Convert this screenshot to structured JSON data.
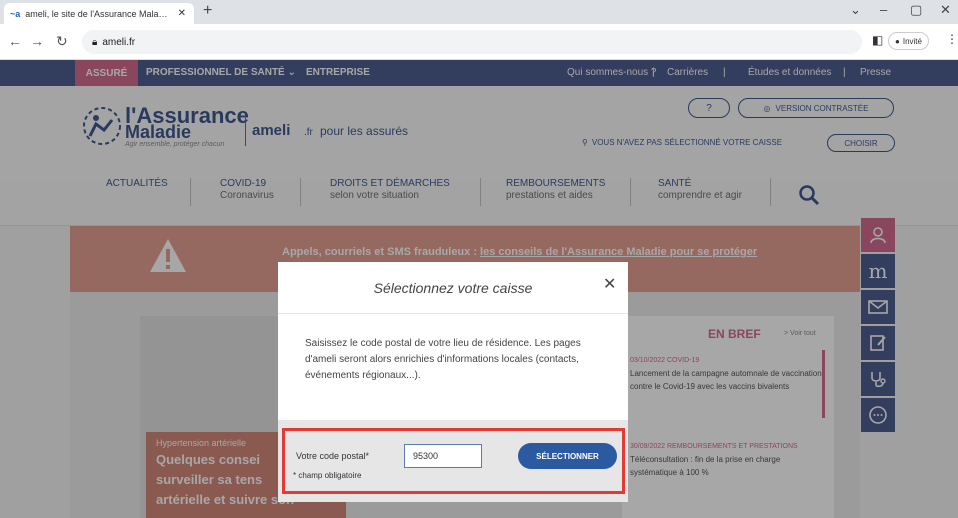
{
  "browser": {
    "tab_title": "ameli, le site de l'Assurance Mala…",
    "tab_favicon": "ameli",
    "url": "ameli.fr",
    "profile_label": "Invité"
  },
  "topnav": {
    "active": "ASSURÉ",
    "links": [
      "PROFESSIONNEL DE SANTÉ",
      "ENTREPRISE"
    ],
    "utility": [
      "Qui sommes-nous ?",
      "|",
      "Carrières",
      "|",
      "Études et données",
      "|",
      "Presse"
    ]
  },
  "header": {
    "logo_line1": "l'Assurance",
    "logo_line2": "Maladie",
    "logo_tagline": "Agir ensemble, protéger chacun",
    "site_name": "ameli",
    "site_tld": ".fr",
    "audience": "pour les assurés",
    "help_label": "?",
    "contrast_label": "VERSION CONTRASTÉE",
    "caisse_message": "VOUS N'AVEZ PAS SÉLECTIONNÉ VOTRE CAISSE",
    "choose_label": "CHOISIR"
  },
  "mainnav": [
    {
      "title": "ACTUALITÉS",
      "sub": ""
    },
    {
      "title": "COVID-19",
      "sub": "Coronavirus"
    },
    {
      "title": "DROITS ET DÉMARCHES",
      "sub": "selon votre situation"
    },
    {
      "title": "REMBOURSEMENTS",
      "sub": "prestations et aides"
    },
    {
      "title": "SANTÉ",
      "sub": "comprendre et agir"
    }
  ],
  "alert": {
    "text_plain": "Appels, courriels et SMS frauduleux : ",
    "text_link": "les conseils de l'Assurance Maladie pour se protéger"
  },
  "hero": {
    "category": "Hypertension artérielle",
    "lines": [
      "Quelques consei",
      "surveiller sa tens",
      "artérielle et suivre son"
    ]
  },
  "bref": {
    "title": "EN BREF",
    "see_all": "> Voir tout",
    "items": [
      {
        "meta": "03/10/2022  COVID-19",
        "text": "Lancement de la campagne automnale de vaccination contre le Covid-19 avec les vaccins bivalents"
      },
      {
        "meta": "30/09/2022  REMBOURSEMENTS ET PRESTATIONS",
        "text": "Téléconsultation : fin de la prise en charge systématique à 100 %"
      }
    ]
  },
  "sidebar": [
    "user-icon",
    "mail-m-icon",
    "envelope-icon",
    "edit-icon",
    "stethoscope-icon",
    "chat-icon"
  ],
  "modal": {
    "title": "Sélectionnez votre caisse",
    "body": "Saisissez le code postal de votre lieu de résidence. Les pages d'ameli seront alors enrichies d'informations locales (contacts, événements régionaux...).",
    "postal_label": "Votre code postal*",
    "postal_value": "95300",
    "required_note": "* champ obligatoire",
    "submit_label": "SÉLECTIONNER",
    "highlight_color": "#e53935"
  },
  "colors": {
    "navy": "#2c3e7a",
    "pink": "#c94f78",
    "alert": "#e08f7e"
  }
}
